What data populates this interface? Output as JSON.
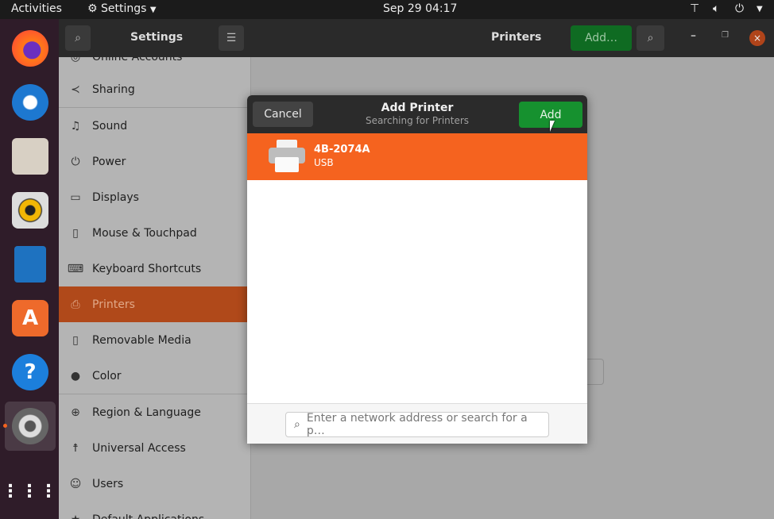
{
  "topbar": {
    "activities": "Activities",
    "app_menu": "Settings",
    "clock": "Sep 29  04:17"
  },
  "dock": {
    "apps": [
      "Firefox",
      "Thunderbird",
      "Files",
      "Rhythmbox",
      "LibreOffice Writer",
      "Ubuntu Software",
      "Help",
      "Settings",
      "Show Applications"
    ]
  },
  "header": {
    "sidebar_title": "Settings",
    "panel_title": "Printers",
    "add_label": "Add…"
  },
  "sidebar": {
    "items": [
      {
        "label": "Online Accounts",
        "icon": "online-accounts-icon"
      },
      {
        "label": "Sharing",
        "icon": "share-icon"
      },
      {
        "label": "Sound",
        "icon": "music-note-icon"
      },
      {
        "label": "Power",
        "icon": "power-icon"
      },
      {
        "label": "Displays",
        "icon": "display-icon"
      },
      {
        "label": "Mouse & Touchpad",
        "icon": "mouse-icon"
      },
      {
        "label": "Keyboard Shortcuts",
        "icon": "keyboard-icon"
      },
      {
        "label": "Printers",
        "icon": "printer-icon",
        "selected": true
      },
      {
        "label": "Removable Media",
        "icon": "usb-drive-icon"
      },
      {
        "label": "Color",
        "icon": "color-icon"
      },
      {
        "label": "Region & Language",
        "icon": "globe-icon"
      },
      {
        "label": "Universal Access",
        "icon": "accessibility-icon"
      },
      {
        "label": "Users",
        "icon": "users-icon"
      },
      {
        "label": "Default Applications",
        "icon": "star-icon"
      }
    ]
  },
  "dialog": {
    "title": "Add Printer",
    "subtitle": "Searching for Printers",
    "cancel_label": "Cancel",
    "add_label": "Add",
    "printers": [
      {
        "name": "4B-2074A",
        "connection": "USB"
      }
    ],
    "search_placeholder": "Enter a network address or search for a p…"
  },
  "colors": {
    "accent": "#f5631f",
    "add_green": "#16912f",
    "selected_sidebar": "#b0491a"
  }
}
